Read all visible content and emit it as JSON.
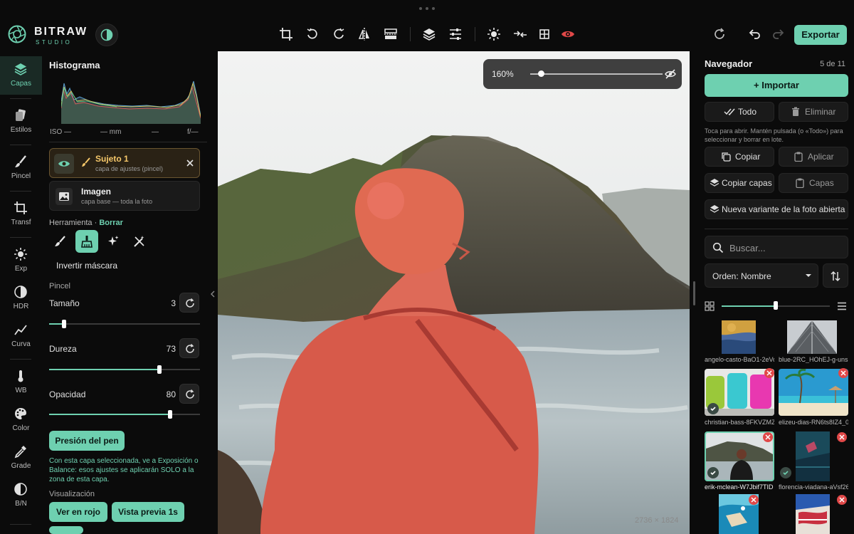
{
  "app": {
    "brand": "BITRAW",
    "brand_sub": "STUDIO"
  },
  "toolbar": {
    "export_label": "Exportar"
  },
  "rail": {
    "items": [
      {
        "label": "Capas",
        "icon": "layers-icon",
        "active": true
      },
      {
        "label": "Estilos",
        "icon": "styles-icon"
      },
      {
        "label": "Pincel",
        "icon": "brush-icon"
      },
      {
        "label": "Transf",
        "icon": "crop-icon"
      },
      {
        "label": "Exp",
        "icon": "sun-icon"
      },
      {
        "label": "HDR",
        "icon": "hdr-icon"
      },
      {
        "label": "Curva",
        "icon": "curve-icon"
      },
      {
        "label": "WB",
        "icon": "thermometer-icon"
      },
      {
        "label": "Color",
        "icon": "palette-icon"
      },
      {
        "label": "Grade",
        "icon": "dropper-icon"
      },
      {
        "label": "B/N",
        "icon": "bw-icon"
      }
    ]
  },
  "left": {
    "histogram_title": "Histograma",
    "exif": {
      "iso": "ISO —",
      "mm": "— mm",
      "dash": "—",
      "f": "f/—"
    },
    "layers": [
      {
        "name": "Sujeto 1",
        "sub": "capa de ajustes (pincel)",
        "selected": true
      },
      {
        "name": "Imagen",
        "sub": "capa base — toda la foto"
      }
    ],
    "tool_label": "Herramienta",
    "tool_sep": "·",
    "tool_current": "Borrar",
    "invert_mask": "Invertir máscara",
    "brush_section": "Pincel",
    "params": [
      {
        "label": "Tamaño",
        "value": "3",
        "fraction": 0.1
      },
      {
        "label": "Dureza",
        "value": "73",
        "fraction": 0.73
      },
      {
        "label": "Opacidad",
        "value": "80",
        "fraction": 0.8
      }
    ],
    "pen_pressure": "Presión del pen",
    "info": "Con esta capa seleccionada, ve a Exposición o Balance: esos ajustes se aplicarán SOLO a la zona de esta capa.",
    "view_section": "Visualización",
    "view_red": "Ver en rojo",
    "view_preview": "Vista previa 1s"
  },
  "canvas": {
    "zoom": "160%",
    "zoom_fraction": 0.08,
    "dimensions": "2736 × 1824"
  },
  "right": {
    "title": "Navegador",
    "count": "5 de 11",
    "import": "Importar",
    "all": "Todo",
    "delete": "Eliminar",
    "hint": "Toca para abrir. Mantén pulsada (o «Todo») para seleccionar y borrar en lote.",
    "copy": "Copiar",
    "apply": "Aplicar",
    "copy_layers": "Copiar capas",
    "layers": "Capas",
    "new_variant": "Nueva variante de la foto abierta",
    "search_placeholder": "Buscar...",
    "sort": "Orden: Nombre",
    "size_fraction": 0.5,
    "thumbs": [
      {
        "name": "angelo-casto-BaO1-2eVo"
      },
      {
        "name": "blue-2RC_HOhEJ-g-uns"
      },
      {
        "name": "christian-bass-8FKVZMZ"
      },
      {
        "name": "elizeu-dias-RN6ts8IZ4_0"
      },
      {
        "name": "erik-mclean-W7Jbif7TID"
      },
      {
        "name": "florencia-viadana-aVsf26"
      }
    ]
  }
}
